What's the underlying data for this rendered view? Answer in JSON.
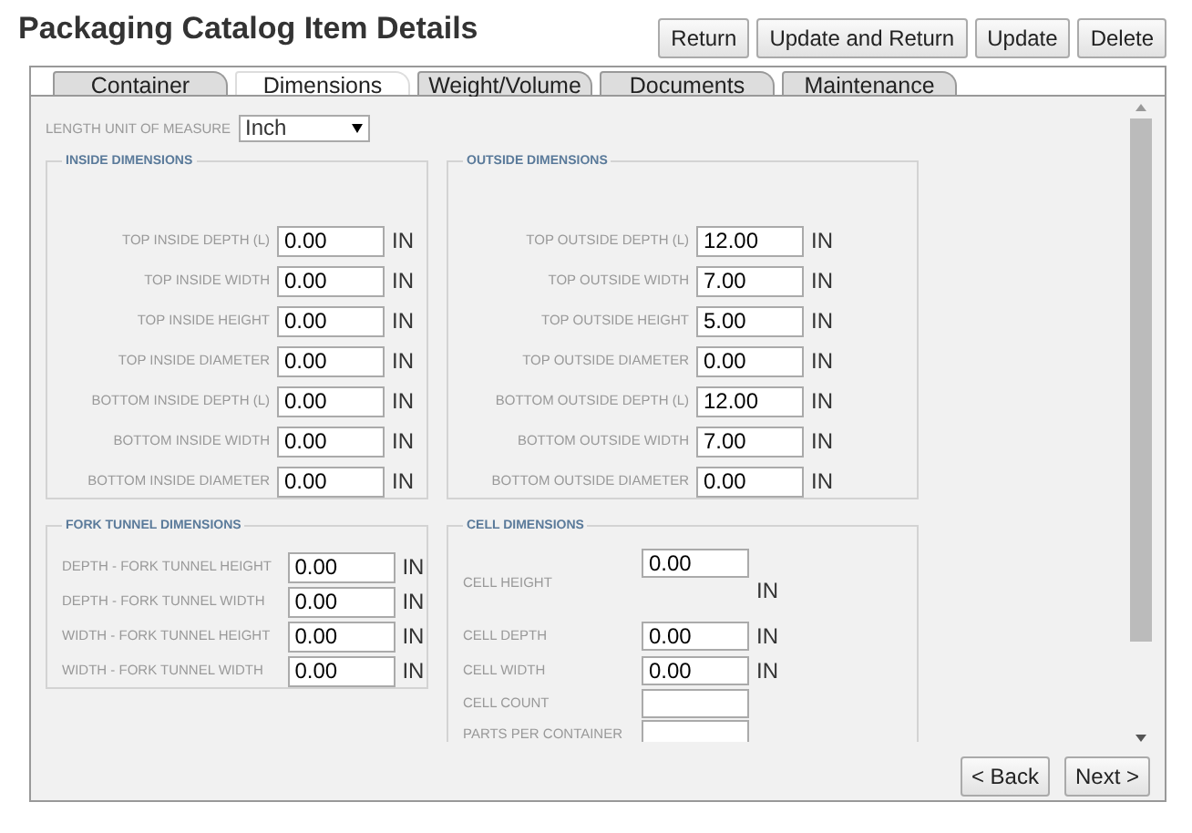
{
  "title": "Packaging Catalog Item Details",
  "actions": [
    "Return",
    "Update and Return",
    "Update",
    "Delete"
  ],
  "tabs": [
    {
      "label": "Container",
      "selected": false
    },
    {
      "label": "Dimensions",
      "selected": true
    },
    {
      "label": "Weight/Volume",
      "selected": false
    },
    {
      "label": "Documents",
      "selected": false
    },
    {
      "label": "Maintenance",
      "selected": false
    }
  ],
  "length_unit": {
    "label": "LENGTH UNIT OF MEASURE",
    "value": "Inch"
  },
  "sections": [
    {
      "title": "INSIDE DIMENSIONS",
      "kind": "right",
      "fields": [
        {
          "label": "TOP INSIDE DEPTH (L)",
          "value": "0.00",
          "unit": "IN"
        },
        {
          "label": "TOP INSIDE WIDTH",
          "value": "0.00",
          "unit": "IN"
        },
        {
          "label": "TOP INSIDE HEIGHT",
          "value": "0.00",
          "unit": "IN"
        },
        {
          "label": "TOP INSIDE DIAMETER",
          "value": "0.00",
          "unit": "IN"
        },
        {
          "label": "BOTTOM INSIDE DEPTH (L)",
          "value": "0.00",
          "unit": "IN"
        },
        {
          "label": "BOTTOM INSIDE WIDTH",
          "value": "0.00",
          "unit": "IN"
        },
        {
          "label": "BOTTOM INSIDE DIAMETER",
          "value": "0.00",
          "unit": "IN"
        }
      ]
    },
    {
      "title": "OUTSIDE DIMENSIONS",
      "kind": "right",
      "fields": [
        {
          "label": "TOP OUTSIDE DEPTH (L)",
          "value": "12.00",
          "unit": "IN"
        },
        {
          "label": "TOP OUTSIDE WIDTH",
          "value": "7.00",
          "unit": "IN"
        },
        {
          "label": "TOP OUTSIDE HEIGHT",
          "value": "5.00",
          "unit": "IN"
        },
        {
          "label": "TOP OUTSIDE DIAMETER",
          "value": "0.00",
          "unit": "IN"
        },
        {
          "label": "BOTTOM OUTSIDE DEPTH (L)",
          "value": "12.00",
          "unit": "IN"
        },
        {
          "label": "BOTTOM OUTSIDE WIDTH",
          "value": "7.00",
          "unit": "IN"
        },
        {
          "label": "BOTTOM OUTSIDE DIAMETER",
          "value": "0.00",
          "unit": "IN"
        }
      ]
    },
    {
      "title": "FORK TUNNEL DIMENSIONS",
      "kind": "left",
      "fields": [
        {
          "label": "DEPTH - FORK TUNNEL HEIGHT",
          "value": "0.00",
          "unit": "IN"
        },
        {
          "label": "DEPTH - FORK TUNNEL WIDTH",
          "value": "0.00",
          "unit": "IN"
        },
        {
          "label": "WIDTH - FORK TUNNEL HEIGHT",
          "value": "0.00",
          "unit": "IN"
        },
        {
          "label": "WIDTH - FORK TUNNEL WIDTH",
          "value": "0.00",
          "unit": "IN"
        }
      ]
    },
    {
      "title": "CELL DIMENSIONS",
      "kind": "cell",
      "fields": [
        {
          "label": "CELL HEIGHT",
          "value": "0.00",
          "unit": "IN",
          "kind": "tall"
        },
        {
          "label": "CELL DEPTH",
          "value": "0.00",
          "unit": "IN"
        },
        {
          "label": "CELL WIDTH",
          "value": "0.00",
          "unit": "IN"
        },
        {
          "label": "CELL COUNT"
        },
        {
          "label": "PARTS PER CONTAINER"
        }
      ]
    }
  ],
  "nav": [
    "< Back",
    "Next >"
  ]
}
